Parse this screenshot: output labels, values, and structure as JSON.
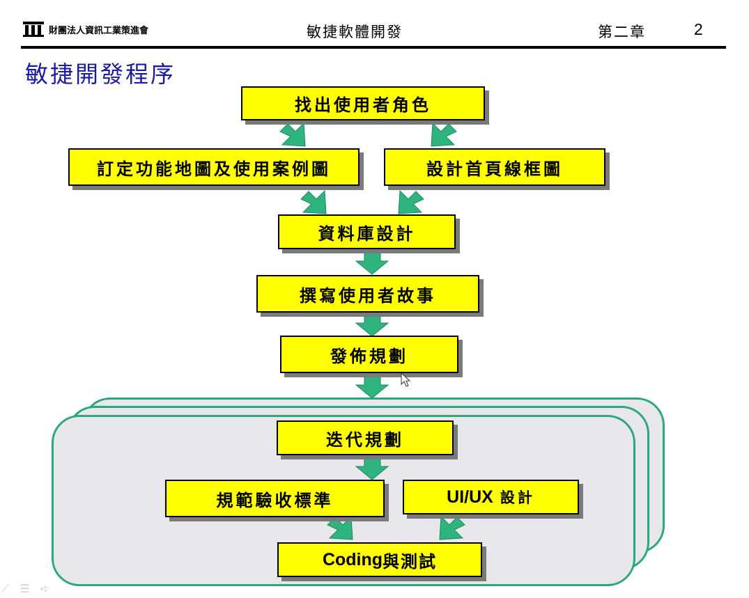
{
  "header": {
    "org_name": "財團法人資訊工業策進會",
    "title": "敏捷軟體開發",
    "chapter": "第二章",
    "page": "2"
  },
  "slide_title": "敏捷開發程序",
  "steps": {
    "find_roles": "找出使用者角色",
    "feature_map": "訂定功能地圖及使用案例圖",
    "wireframe": "設計首頁線框圖",
    "db_design": "資料庫設計",
    "user_stories": "撰寫使用者故事",
    "release_plan": "發佈規劃",
    "iteration_plan": "迭代規劃",
    "acceptance": "規範驗收標準",
    "uiux_latin": "UI/UX",
    "uiux_cjk": "設計",
    "coding_latin": "Coding",
    "coding_cjk": "與測試"
  },
  "colors": {
    "box_fill": "#ffff00",
    "arrow_fill": "#2fb37f",
    "panel_fill": "#e7e7ec",
    "panel_border": "#2aa97a",
    "title_color": "#1a1aa6"
  }
}
